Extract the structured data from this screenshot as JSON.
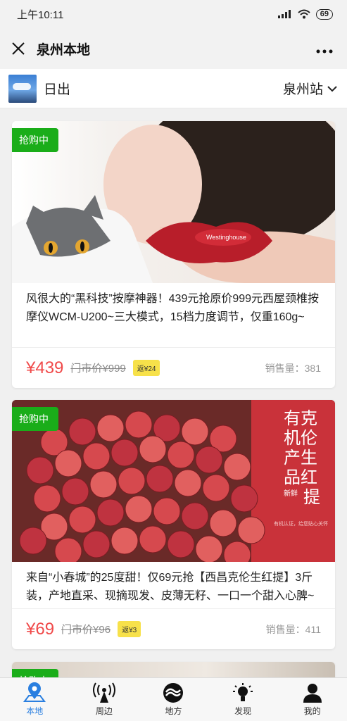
{
  "status": {
    "time": "上午10:11",
    "battery": "69"
  },
  "nav": {
    "title": "泉州本地"
  },
  "location": {
    "name": "日出",
    "station": "泉州站"
  },
  "products": [
    {
      "tag": "抢购中",
      "description": "风很大的“黑科技”按摩神器！439元抢原价999元西屋颈椎按摩仪WCM-U200~三大模式，15档力度调节，仅重160g~",
      "price": "¥439",
      "original_price": "门市价¥999",
      "rebate": "返¥24",
      "sold": "销售量：381",
      "image_label": "Westinghouse"
    },
    {
      "tag": "抢购中",
      "description": "来自“小春城”的25度甜！仅69元抢【西昌克伦生红提】3斤装，产地直采、现摘现发、皮薄无籽、一口一个甜入心脾~",
      "price": "¥69",
      "original_price": "门市价¥96",
      "rebate": "返¥3",
      "sold": "销售量：411",
      "poster": {
        "line1": "有克",
        "line2": "机伦",
        "line3": "产生",
        "line4": "品红",
        "line5": "提",
        "fresh": "新鲜",
        "note": "有机认证，给您贴心关怀"
      }
    },
    {
      "tag": "抢购中"
    }
  ],
  "tabs": [
    {
      "label": "本地",
      "icon": "location-pin-icon",
      "active": true
    },
    {
      "label": "周边",
      "icon": "broadcast-tower-icon",
      "active": false
    },
    {
      "label": "地方",
      "icon": "swirl-logo-icon",
      "active": false
    },
    {
      "label": "发现",
      "icon": "lightbulb-icon",
      "active": false
    },
    {
      "label": "我的",
      "icon": "person-icon",
      "active": false
    }
  ],
  "colors": {
    "accent": "#1aad19",
    "price": "#f04a4a",
    "tab_active": "#2a7fe0"
  }
}
